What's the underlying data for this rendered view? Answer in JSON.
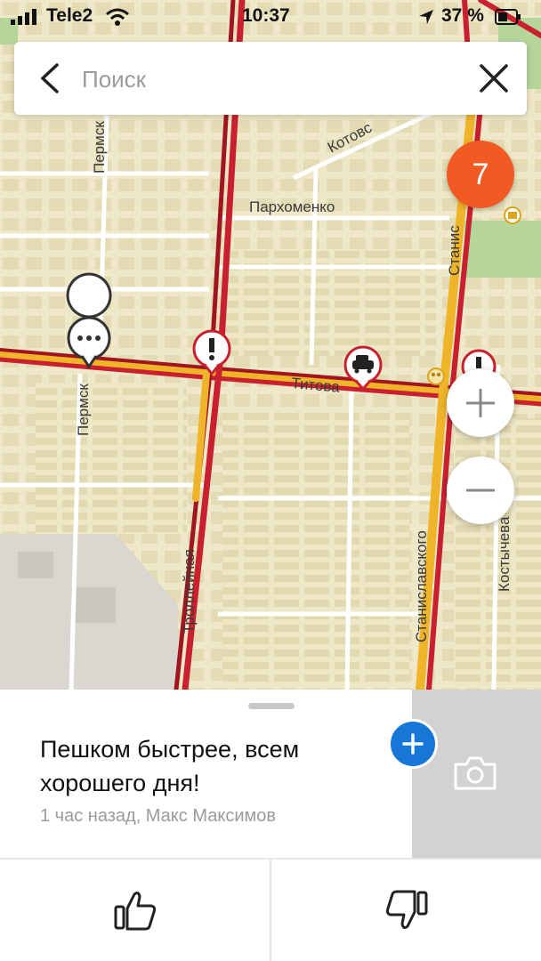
{
  "status_bar": {
    "carrier": "Tele2",
    "time": "10:37",
    "battery": "37 %"
  },
  "search": {
    "placeholder": "Поиск"
  },
  "map": {
    "street_labels": [
      "Пермск",
      "Пермск",
      "Пархоменко",
      "Котовс",
      "Титова",
      "Троллейная",
      "Станиславского",
      "Станис",
      "Костычева"
    ],
    "events_badge": "7",
    "colors": {
      "land": "#efe8c8",
      "block": "#e3dbb4",
      "traffic_red": "#c8202e",
      "traffic_yellow": "#f0b42a",
      "park": "#b6d59b",
      "badge": "#f15a22"
    },
    "icons": [
      "chat-bubble-icon",
      "warning-icon",
      "car-accident-icon",
      "warning-icon",
      "museum-icon",
      "theater-icon"
    ]
  },
  "sheet": {
    "comment": "Пешком быстрее, всем хорошего дня!",
    "meta": "1 час назад, Макс Максимов",
    "accent": "#1677d6"
  }
}
